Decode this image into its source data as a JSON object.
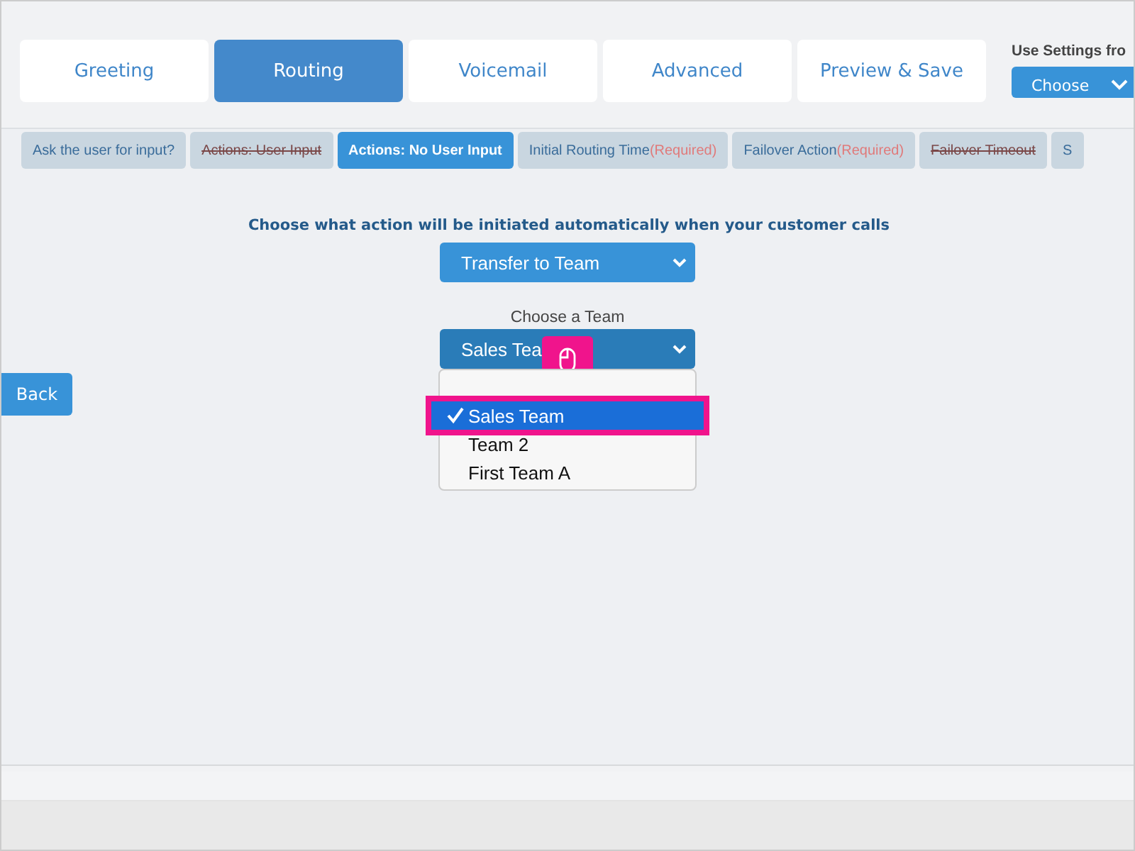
{
  "tabs": [
    {
      "label": "Greeting",
      "selected": false
    },
    {
      "label": "Routing",
      "selected": true
    },
    {
      "label": "Voicemail",
      "selected": false
    },
    {
      "label": "Advanced",
      "selected": false
    },
    {
      "label": "Preview & Save",
      "selected": false
    }
  ],
  "settings": {
    "label": "Use Settings fro",
    "select": "Choose"
  },
  "subtabs": [
    {
      "label": "Ask the user for input?",
      "selected": false,
      "crossed": false
    },
    {
      "label": "Actions: User Input",
      "selected": false,
      "crossed": true
    },
    {
      "label": "Actions: No User Input",
      "selected": true,
      "crossed": false
    },
    {
      "label": "Initial Routing Time",
      "note": "(Required)",
      "selected": false,
      "crossed": false
    },
    {
      "label": "Failover Action",
      "note": "(Required)",
      "selected": false,
      "crossed": false
    },
    {
      "label": "Failover Timeout",
      "selected": false,
      "crossed": true
    },
    {
      "label": "S",
      "selected": false,
      "crossed": false
    }
  ],
  "prompt": "Choose what action will be initiated automatically when your customer calls",
  "action_select": "Transfer to Team",
  "team_label": "Choose a Team",
  "team_select": "Sales Tea",
  "team_options": [
    {
      "label": "Sales Team",
      "selected": true
    },
    {
      "label": "Team 2",
      "selected": false
    },
    {
      "label": "First Team A",
      "selected": false
    }
  ],
  "back_button": "Back"
}
